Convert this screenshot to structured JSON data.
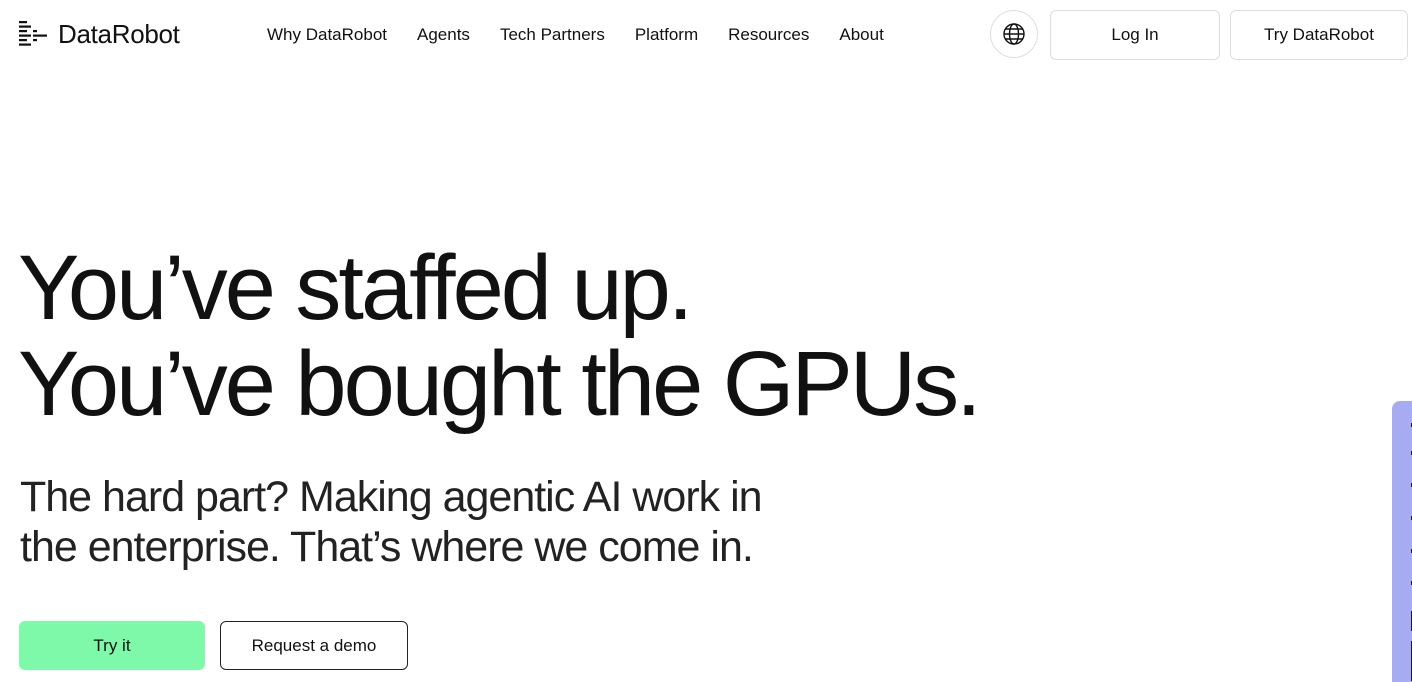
{
  "brand": {
    "name": "DataRobot",
    "colors": {
      "accent_green": "#7ef8a9",
      "side_widget": "#a7acf2",
      "text": "#111111"
    }
  },
  "header": {
    "logo_icon": "datarobot-logo-icon",
    "nav": [
      {
        "label": "Why DataRobot"
      },
      {
        "label": "Agents"
      },
      {
        "label": "Tech Partners"
      },
      {
        "label": "Platform"
      },
      {
        "label": "Resources"
      },
      {
        "label": "About"
      }
    ],
    "globe_icon": "globe-icon",
    "login_label": "Log In",
    "try_label": "Try DataRobot"
  },
  "hero": {
    "title_line1": "You’ve staffed up.",
    "title_line2": "You’ve bought the GPUs.",
    "subtitle_line1": "The hard part? Making agentic AI work in",
    "subtitle_line2": "the enterprise. That’s where we come in.",
    "cta_primary": "Try it",
    "cta_secondary": "Request a demo"
  }
}
